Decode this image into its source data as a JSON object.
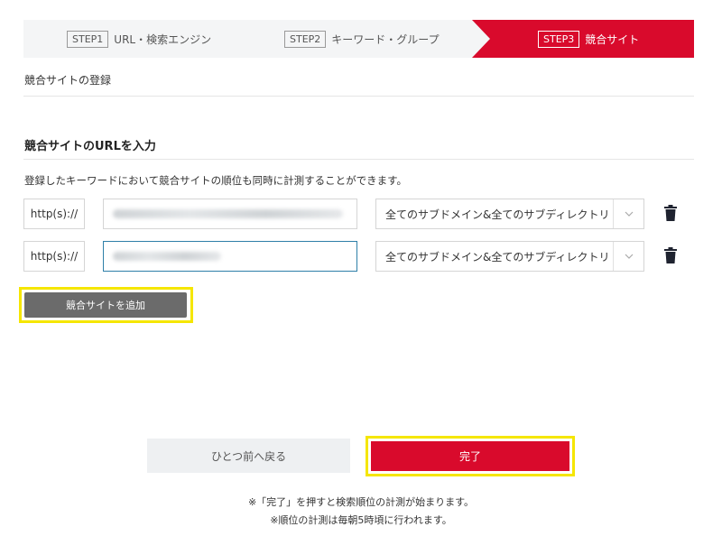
{
  "steps": [
    {
      "num": "STEP1",
      "label": "URL・検索エンジン"
    },
    {
      "num": "STEP2",
      "label": "キーワード・グループ"
    },
    {
      "num": "STEP3",
      "label": "競合サイト"
    }
  ],
  "section_title": "競合サイトの登録",
  "sub_title": "競合サイトのURLを入力",
  "description": "登録したキーワードにおいて競合サイトの順位も同時に計測することができます。",
  "rows": [
    {
      "prefix": "http(s)://",
      "select_value": "全てのサブドメイン&全てのサブディレクトリ"
    },
    {
      "prefix": "http(s)://",
      "select_value": "全てのサブドメイン&全てのサブディレクトリ"
    }
  ],
  "add_button": "競合サイトを追加",
  "back_button": "ひとつ前へ戻る",
  "done_button": "完了",
  "notes": [
    "※「完了」を押すと検索順位の計測が始まります。",
    "※順位の計測は毎朝5時頃に行われます。"
  ],
  "colors": {
    "accent": "#d90a2c",
    "highlight": "#f5e600",
    "add_button": "#6b6b6b"
  }
}
